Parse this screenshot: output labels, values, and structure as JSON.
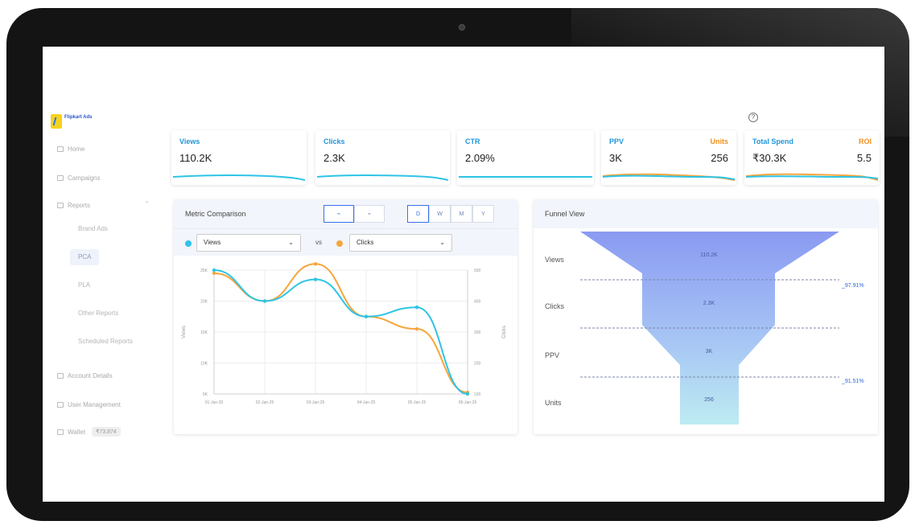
{
  "brand": {
    "logo_text": "Flipkart Ads"
  },
  "header": {
    "help_icon": "question-circle-icon",
    "help_glyph": "?"
  },
  "sidebar": {
    "items": [
      {
        "label": "Home",
        "icon": "home-icon"
      },
      {
        "label": "Campaigns",
        "icon": "campaign-icon"
      },
      {
        "label": "Reports",
        "icon": "reports-icon",
        "expanded": true
      },
      {
        "label": "Account Details",
        "icon": "account-icon"
      },
      {
        "label": "User Management",
        "icon": "users-icon"
      },
      {
        "label": "Wallet",
        "icon": "wallet-icon",
        "badge": "₹73,874"
      }
    ],
    "report_subitems": [
      "Brand Ads",
      "PCA",
      "PLA",
      "Other Reports",
      "Scheduled Reports"
    ],
    "active_subitem": "PCA"
  },
  "kpis": [
    {
      "label": "Views",
      "value": "110.2K"
    },
    {
      "label": "Clicks",
      "value": "2.3K"
    },
    {
      "label": "CTR",
      "value": "2.09%"
    },
    {
      "label": "PPV",
      "value": "3K",
      "label2": "Units",
      "value2": "256"
    },
    {
      "label": "Total Spend",
      "value": "₹30.3K",
      "label2": "ROI",
      "value2": "5.5"
    }
  ],
  "colors": {
    "primary": "#2196d9",
    "secondary": "#f0901e",
    "series_a": "#2ec4e6",
    "series_b": "#f5a63c",
    "accent": "#3a6ff0"
  },
  "metric_comparison": {
    "title": "Metric Comparison",
    "chart_type_buttons": [
      "line-chart-icon",
      "bar-chart-icon"
    ],
    "chart_type_glyphs": [
      "⌁",
      "⌁"
    ],
    "granularity": [
      "D",
      "W",
      "M",
      "Y"
    ],
    "granularity_selected": "D",
    "metric_a": "Views",
    "metric_b": "Clicks",
    "vs_label": "vs",
    "dropdown_icon": "chevron-down-icon",
    "caret": "⌄"
  },
  "chart_data": {
    "type": "line",
    "title": "",
    "xlabel": "",
    "ylabel": "Views",
    "y2label": "Clicks",
    "categories": [
      "01-Jan-25",
      "02-Jan-25",
      "03-Jan-25",
      "04-Jan-25",
      "05-Jan-25",
      "06-Jan-25"
    ],
    "y_ticks": [
      "5K",
      "10K",
      "15K",
      "20K",
      "25K"
    ],
    "y2_ticks": [
      "100",
      "200",
      "300",
      "400",
      "500"
    ],
    "ylim": [
      5000,
      25000
    ],
    "y2lim": [
      100,
      500
    ],
    "series": [
      {
        "name": "Views",
        "axis": "left",
        "values": [
          25000,
          20000,
          23500,
          17500,
          19000,
          5000
        ]
      },
      {
        "name": "Clicks",
        "axis": "right",
        "values": [
          490,
          400,
          520,
          350,
          310,
          105
        ]
      }
    ],
    "grid": true
  },
  "funnel": {
    "title": "Funnel View",
    "stages": [
      {
        "label": "Views",
        "value": "110.2K"
      },
      {
        "label": "Clicks",
        "value": "2.3K"
      },
      {
        "label": "PPV",
        "value": "3K"
      },
      {
        "label": "Units",
        "value": "256"
      }
    ],
    "conversions": [
      "_97.91%",
      "_91.51%"
    ]
  }
}
